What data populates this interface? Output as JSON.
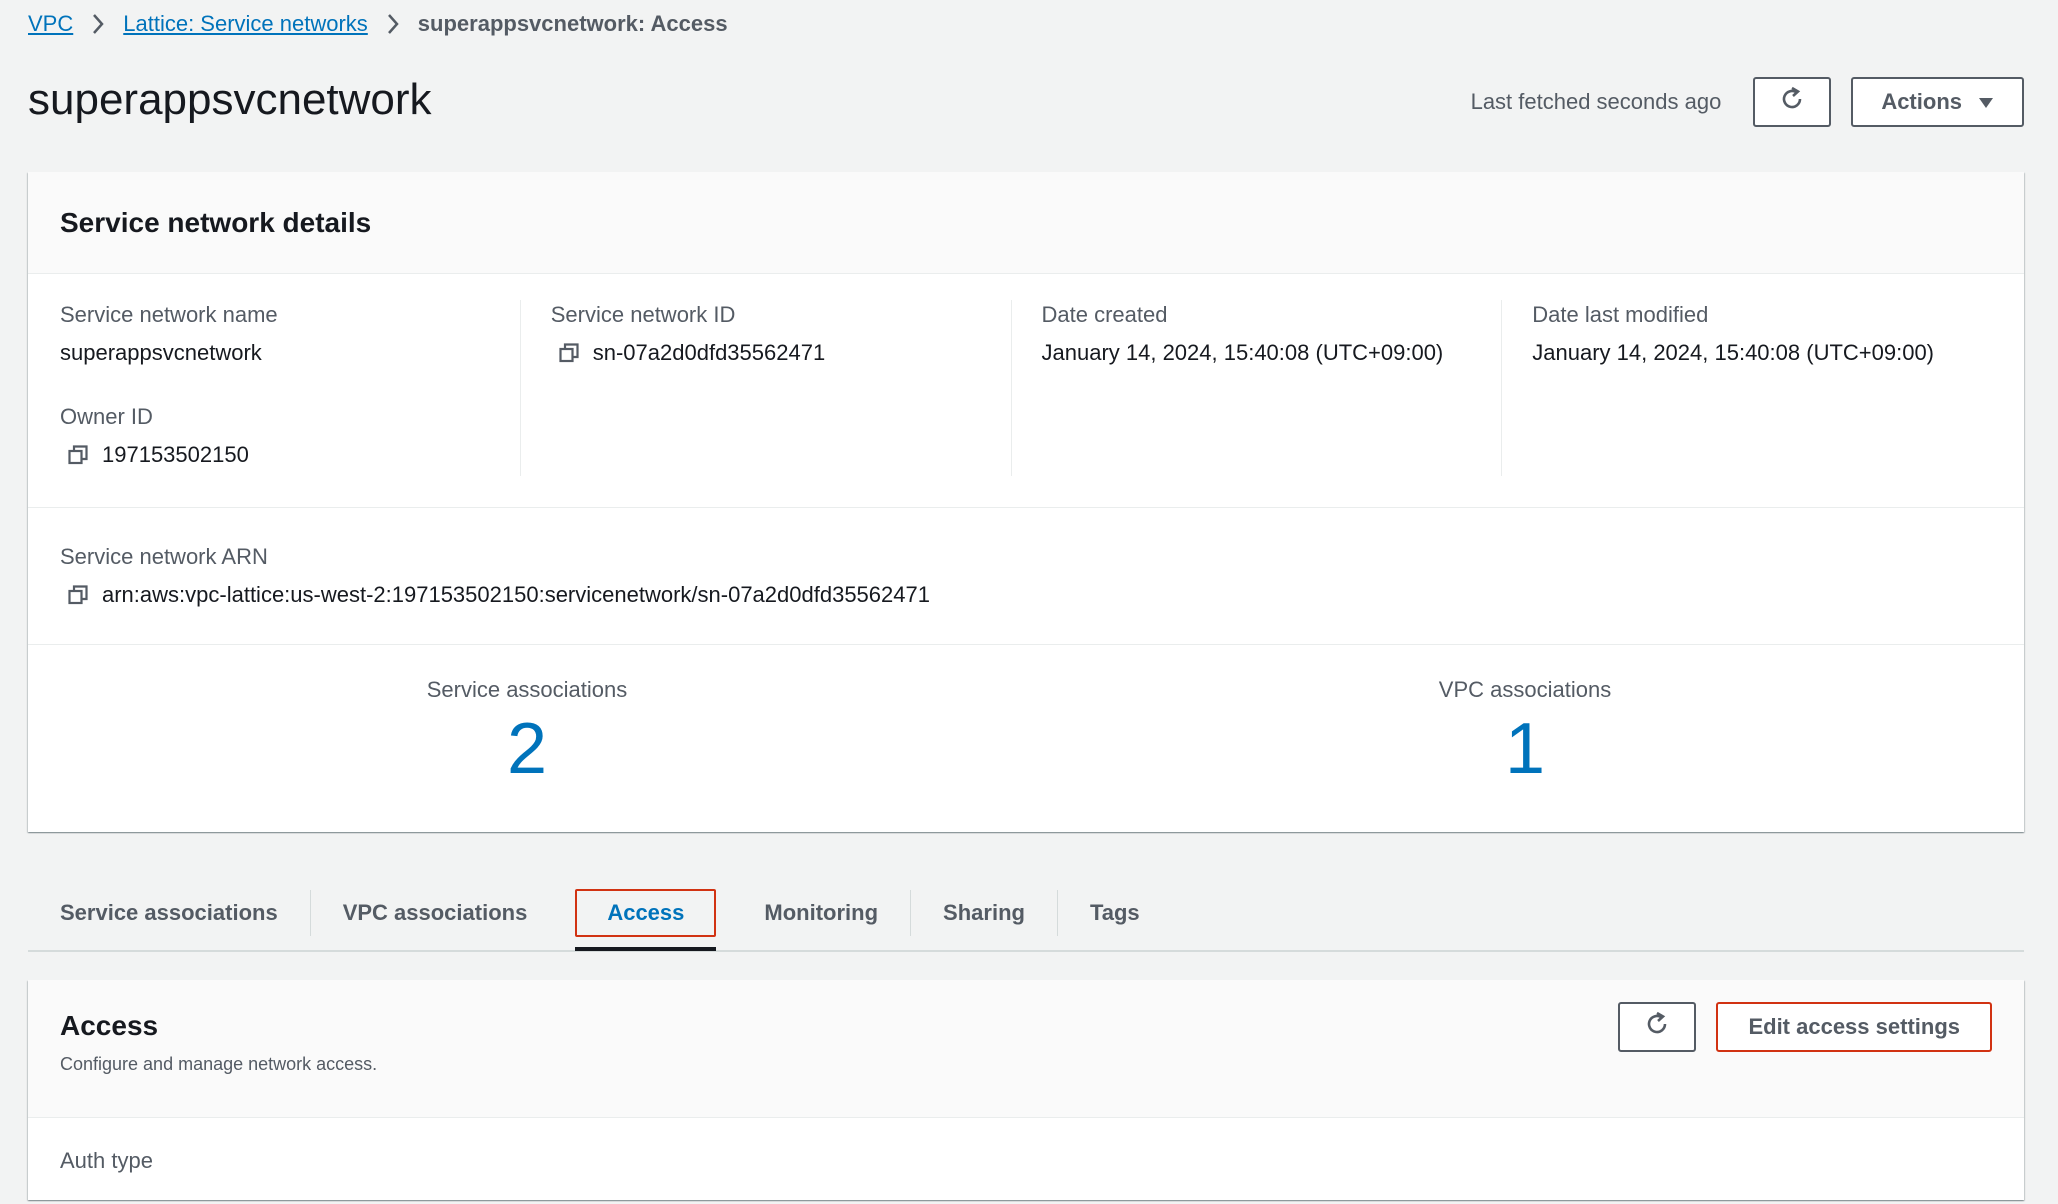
{
  "breadcrumb": {
    "items": [
      "VPC",
      "Lattice: Service networks"
    ],
    "current": "superappsvcnetwork: Access"
  },
  "header": {
    "title": "superappsvcnetwork",
    "last_fetched": "Last fetched seconds ago",
    "actions_label": "Actions"
  },
  "details": {
    "title": "Service network details",
    "name_label": "Service network name",
    "name_value": "superappsvcnetwork",
    "owner_label": "Owner ID",
    "owner_value": "197153502150",
    "id_label": "Service network ID",
    "id_value": "sn-07a2d0dfd35562471",
    "created_label": "Date created",
    "created_value": "January 14, 2024, 15:40:08 (UTC+09:00)",
    "modified_label": "Date last modified",
    "modified_value": "January 14, 2024, 15:40:08 (UTC+09:00)",
    "arn_label": "Service network ARN",
    "arn_value": "arn:aws:vpc-lattice:us-west-2:197153502150:servicenetwork/sn-07a2d0dfd35562471",
    "service_assoc_label": "Service associations",
    "service_assoc_count": "2",
    "vpc_assoc_label": "VPC associations",
    "vpc_assoc_count": "1"
  },
  "tabs": [
    {
      "label": "Service associations"
    },
    {
      "label": "VPC associations"
    },
    {
      "label": "Access",
      "active": true
    },
    {
      "label": "Monitoring"
    },
    {
      "label": "Sharing"
    },
    {
      "label": "Tags"
    }
  ],
  "access": {
    "title": "Access",
    "description": "Configure and manage network access.",
    "edit_label": "Edit access settings",
    "auth_type_label": "Auth type"
  },
  "colors": {
    "link": "#0073bb",
    "highlight_border": "#d13212",
    "background": "#f2f3f3"
  },
  "icons": [
    "chevron-right-icon",
    "refresh-icon",
    "caret-down-icon",
    "copy-icon"
  ]
}
